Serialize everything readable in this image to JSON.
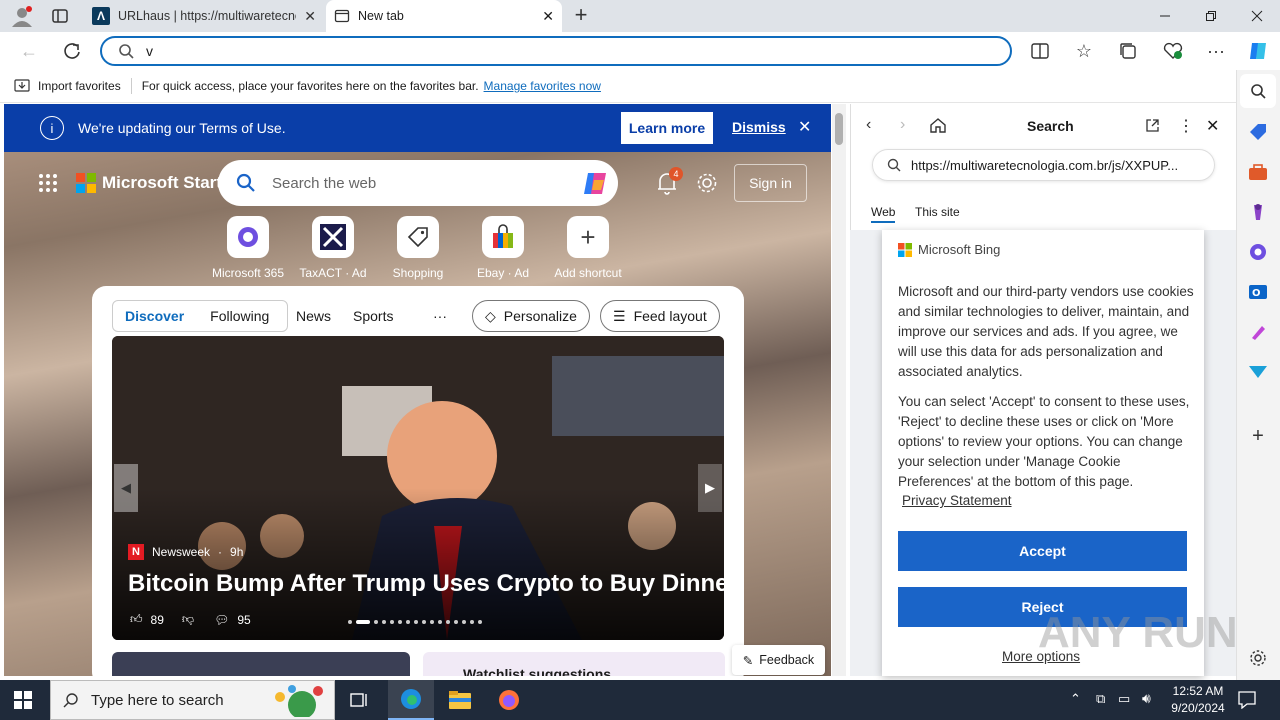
{
  "browser": {
    "tabs": [
      {
        "title": "URLhaus | https://multiwaretecnologia.c",
        "active": false
      },
      {
        "title": "New tab",
        "active": true
      }
    ],
    "address_value": "v",
    "favorites_bar": {
      "import_label": "Import favorites",
      "message": "For quick access, place your favorites here on the favorites bar.",
      "manage_link": "Manage favorites now"
    }
  },
  "newtab": {
    "terms": {
      "text": "We're updating our Terms of Use.",
      "learn_more": "Learn more",
      "dismiss": "Dismiss"
    },
    "brand": "Microsoft Start",
    "search_placeholder": "Search the web",
    "notification_count": "4",
    "sign_in": "Sign in",
    "shortcuts": [
      {
        "label": "Microsoft 365"
      },
      {
        "label": "TaxACT · Ad"
      },
      {
        "label": "Shopping"
      },
      {
        "label": "Ebay · Ad"
      },
      {
        "label": "Add shortcut"
      }
    ],
    "feed_tabs": [
      "Discover",
      "Following",
      "News",
      "Sports",
      "···"
    ],
    "personalize": "Personalize",
    "feed_layout": "Feed layout",
    "hero": {
      "source": "Newsweek",
      "age": "9h",
      "headline": "Bitcoin Bump After Trump Uses Crypto to Buy Dinner",
      "likes": "89",
      "comments": "95"
    },
    "watchlist": "Watchlist suggestions",
    "feedback": "Feedback"
  },
  "search_pane": {
    "title": "Search",
    "query": "https://multiwaretecnologia.com.br/js/XXPUP...",
    "tabs": [
      "Web",
      "This site"
    ],
    "bing_brand": "Microsoft Bing",
    "consent_p1": "Microsoft and our third-party vendors use cookies and similar technologies to deliver, maintain, and improve our services and ads. If you agree, we will use this data for ads personalization and associated analytics.",
    "consent_p2": "You can select 'Accept' to consent to these uses, 'Reject' to decline these uses or click on 'More options' to review your options. You can change your selection under 'Manage Cookie Preferences' at the bottom of this page.",
    "privacy_link": "Privacy Statement",
    "accept": "Accept",
    "reject": "Reject",
    "more_options": "More options"
  },
  "taskbar": {
    "search_placeholder": "Type here to search",
    "time": "12:52 AM",
    "date": "9/20/2024"
  },
  "watermark": "ANY RUN",
  "colors": {
    "accent": "#0f6cbd",
    "terms_bar": "#0a3ea8",
    "consent_button": "#1a64c8",
    "taskbar": "#1f2a3a"
  }
}
